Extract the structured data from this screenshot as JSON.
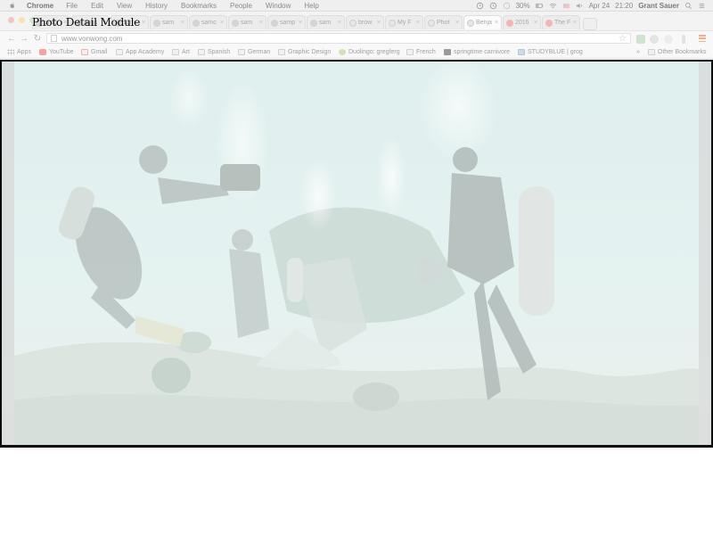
{
  "module": {
    "title": "Photo Detail Module"
  },
  "menubar": {
    "app_name": "Chrome",
    "items": [
      "File",
      "Edit",
      "View",
      "History",
      "Bookmarks",
      "People",
      "Window",
      "Help"
    ],
    "battery": "30%",
    "date": "Apr 24",
    "time": "21:20",
    "user": "Grant Sauer",
    "status_icons": [
      "timer-icon",
      "clock-icon",
      "cloud-icon",
      "battery-icon",
      "wifi-icon",
      "flag-icon",
      "volume-icon",
      "search-icon",
      "list-icon"
    ]
  },
  "browser": {
    "tabs": [
      {
        "label": "grog",
        "icon": "github-icon"
      },
      {
        "label": "apps",
        "icon": "github-icon"
      },
      {
        "label": "sam",
        "icon": "github-icon"
      },
      {
        "label": "sam",
        "icon": "github-icon"
      },
      {
        "label": "samc",
        "icon": "github-icon"
      },
      {
        "label": "sam",
        "icon": "github-icon"
      },
      {
        "label": "samp",
        "icon": "github-icon"
      },
      {
        "label": "sam",
        "icon": "github-icon"
      },
      {
        "label": "brow",
        "icon": "document-icon"
      },
      {
        "label": "My F",
        "icon": "document-icon"
      },
      {
        "label": "Phot",
        "icon": "document-icon"
      },
      {
        "label": "Benja",
        "icon": "document-icon",
        "active": true
      },
      {
        "label": "2016",
        "icon": "red-icon"
      },
      {
        "label": "The F",
        "icon": "red-icon"
      }
    ],
    "url": "www.vonwong.com",
    "bookmarks": [
      {
        "label": "Apps",
        "icon": "apps-grid-icon"
      },
      {
        "label": "YouTube",
        "icon": "youtube-icon"
      },
      {
        "label": "Gmail",
        "icon": "gmail-icon"
      },
      {
        "label": "App Academy",
        "icon": "folder-icon"
      },
      {
        "label": "Art",
        "icon": "folder-icon"
      },
      {
        "label": "Spanish",
        "icon": "folder-icon"
      },
      {
        "label": "German",
        "icon": "folder-icon"
      },
      {
        "label": "Graphic Design",
        "icon": "folder-icon"
      },
      {
        "label": "Duolingo: gregferg",
        "icon": "duolingo-icon"
      },
      {
        "label": "French",
        "icon": "folder-icon"
      },
      {
        "label": "springtime carnivore",
        "icon": "soundcloud-icon"
      },
      {
        "label": "STUDYBLUE | grog",
        "icon": "studyblue-icon"
      }
    ],
    "overflow": "»",
    "other_bookmarks": "Other Bookmarks"
  },
  "colors": {
    "photo_water": "#dcefec",
    "photo_overlay": "#ffffff",
    "frame": "#0b0b0b",
    "menu_accent": "#f2b08a"
  }
}
